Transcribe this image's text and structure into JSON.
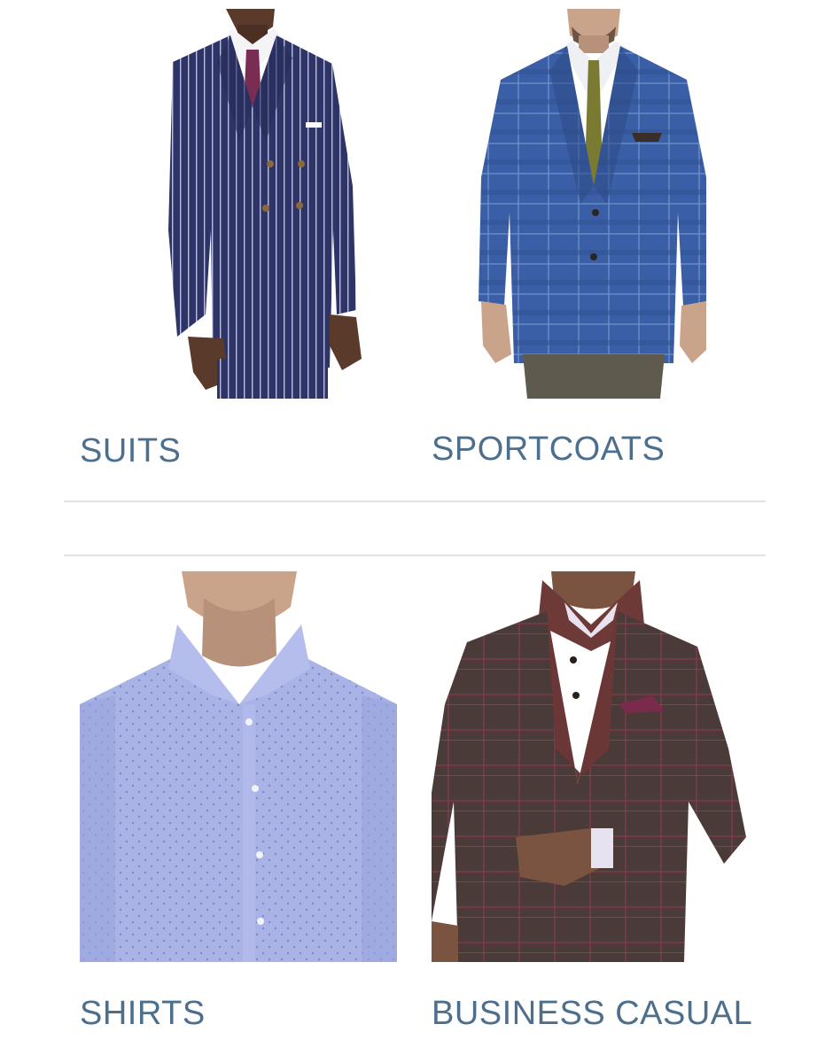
{
  "categories": {
    "suits": {
      "label": "SUITS",
      "image": "navy-pinstripe-double-breasted-suit-photo"
    },
    "sportcoats": {
      "label": "SPORTCOATS",
      "image": "blue-plaid-sportcoat-photo"
    },
    "shirts": {
      "label": "SHIRTS",
      "image": "light-blue-dot-dress-shirt-photo"
    },
    "business_casual": {
      "label": "BUSINESS CASUAL",
      "image": "brown-plaid-blazer-with-sweater-photo"
    }
  },
  "colors": {
    "label_text": "#4d6f8e",
    "divider": "#e3e3e3",
    "background": "#ffffff"
  }
}
